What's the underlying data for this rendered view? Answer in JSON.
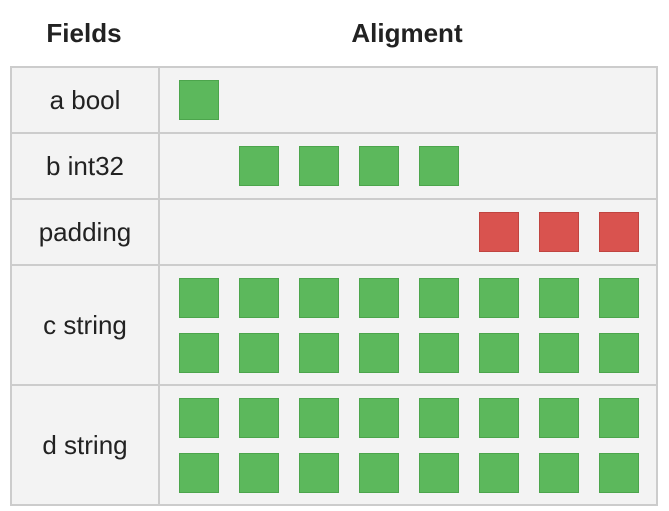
{
  "header": {
    "fields_label": "Fields",
    "alignment_label": "Aligment"
  },
  "colors": {
    "field": "#5cb85c",
    "padding": "#d9534f",
    "row_background": "#f3f3f3",
    "border": "#cccccc"
  },
  "rows": [
    {
      "label": "a bool",
      "kind": "field",
      "byte_start": 0,
      "byte_count": 1,
      "lines": 1
    },
    {
      "label": "b int32",
      "kind": "field",
      "byte_start": 1,
      "byte_count": 4,
      "lines": 1
    },
    {
      "label": "padding",
      "kind": "padding",
      "byte_start": 5,
      "byte_count": 3,
      "lines": 1
    },
    {
      "label": "c string",
      "kind": "field",
      "byte_start": 0,
      "byte_count": 8,
      "lines": 2
    },
    {
      "label": "d string",
      "kind": "field",
      "byte_start": 0,
      "byte_count": 8,
      "lines": 2
    }
  ]
}
